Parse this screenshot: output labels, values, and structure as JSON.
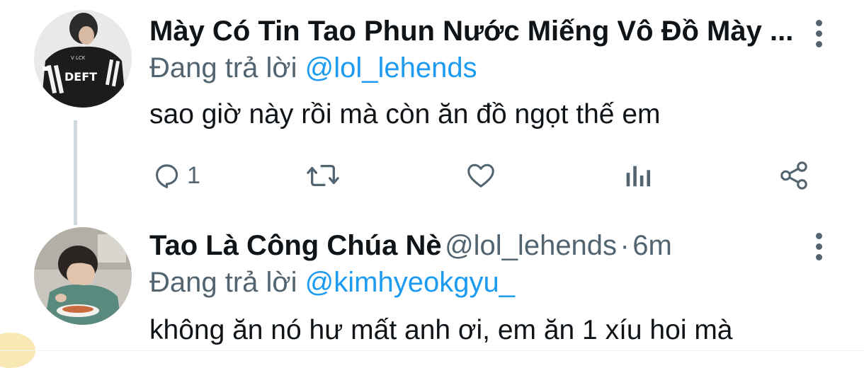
{
  "tweet1": {
    "avatar_alt": "DEFT",
    "name": "Mày Có Tin Tao Phun Nước Miếng Vô Đồ Mày ...",
    "replying_prefix": "Đang trả lời",
    "replying_handle": "@lol_lehends",
    "text": "sao giờ này rồi mà còn ăn đồ ngọt thế em",
    "actions": {
      "reply_icon": "reply-icon",
      "reply_count": "1",
      "retweet_icon": "retweet-icon",
      "like_icon": "heart-icon",
      "analytics_icon": "analytics-icon",
      "share_icon": "share-icon"
    }
  },
  "tweet2": {
    "name": "Tao Là Công Chúa Nè",
    "handle": "@lol_lehends",
    "separator": "·",
    "time": "6m",
    "replying_prefix": "Đang trả lời",
    "replying_handle": "@kimhyeokgyu_",
    "text": "không ăn nó hư mất anh ơi, em ăn 1 xíu hoi mà"
  },
  "colors": {
    "text_primary": "#0f1419",
    "text_secondary": "#536471",
    "link": "#1d9bf0",
    "thread_line": "#cfd9de"
  }
}
